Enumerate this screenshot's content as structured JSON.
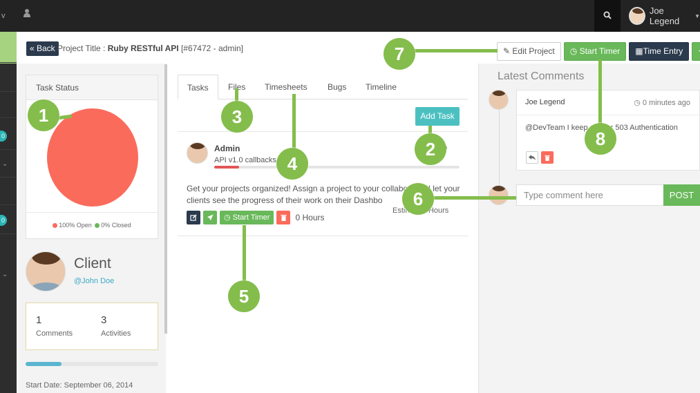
{
  "topbar": {
    "left_glyph": "v",
    "user_name": "Joe Legend"
  },
  "header": {
    "back_label": "« Back",
    "project_prefix": "Project Title :",
    "project_name": "Ruby RESTful API",
    "project_id": "[#67472 - admin]"
  },
  "actions": {
    "edit_project": "Edit Project",
    "start_timer": "Start Timer",
    "time_entry": "Time Entry"
  },
  "rail_badges": [
    "0",
    "0"
  ],
  "task_status": {
    "title": "Task Status",
    "open_pct": 100,
    "closed_pct": 0,
    "legend_open": "100% Open",
    "legend_closed": "0% Closed",
    "open_color": "#fb6b5b",
    "closed_color": "#69b85a"
  },
  "client": {
    "name": "Client",
    "handle": "@John Doe",
    "comments_count": "1",
    "comments_label": "Comments",
    "activities_count": "3",
    "activities_label": "Activities",
    "progress": 0.27,
    "start_date": "Start Date: September 06, 2014"
  },
  "tabs": [
    "Tasks",
    "Files",
    "Timesheets",
    "Bugs",
    "Timeline"
  ],
  "add_task_label": "Add Task",
  "task": {
    "author": "Admin",
    "time_suffix": "ago",
    "title": "API v1.0 callbacks",
    "progress": 0.1,
    "description": "Get your projects organized! Assign a project to your collabo          s and let your clients see the progress of their work on their Dashbo",
    "estimate": "Estim    230 Hours",
    "start_timer": "Start Timer",
    "hours": "0 Hours"
  },
  "comments": {
    "title": "Latest Comments",
    "author": "Joe Legend",
    "time": "0 minutes ago",
    "body": "@DevTeam I keep g         Error 503 Authentication",
    "input_placeholder": "Type comment here",
    "post_label": "POST"
  },
  "annotations": [
    "1",
    "2",
    "3",
    "4",
    "5",
    "6",
    "7",
    "8"
  ],
  "colors": {
    "accent_green": "#84bd4c",
    "teal": "#4cc0c1",
    "dark": "#2b3a4d"
  }
}
